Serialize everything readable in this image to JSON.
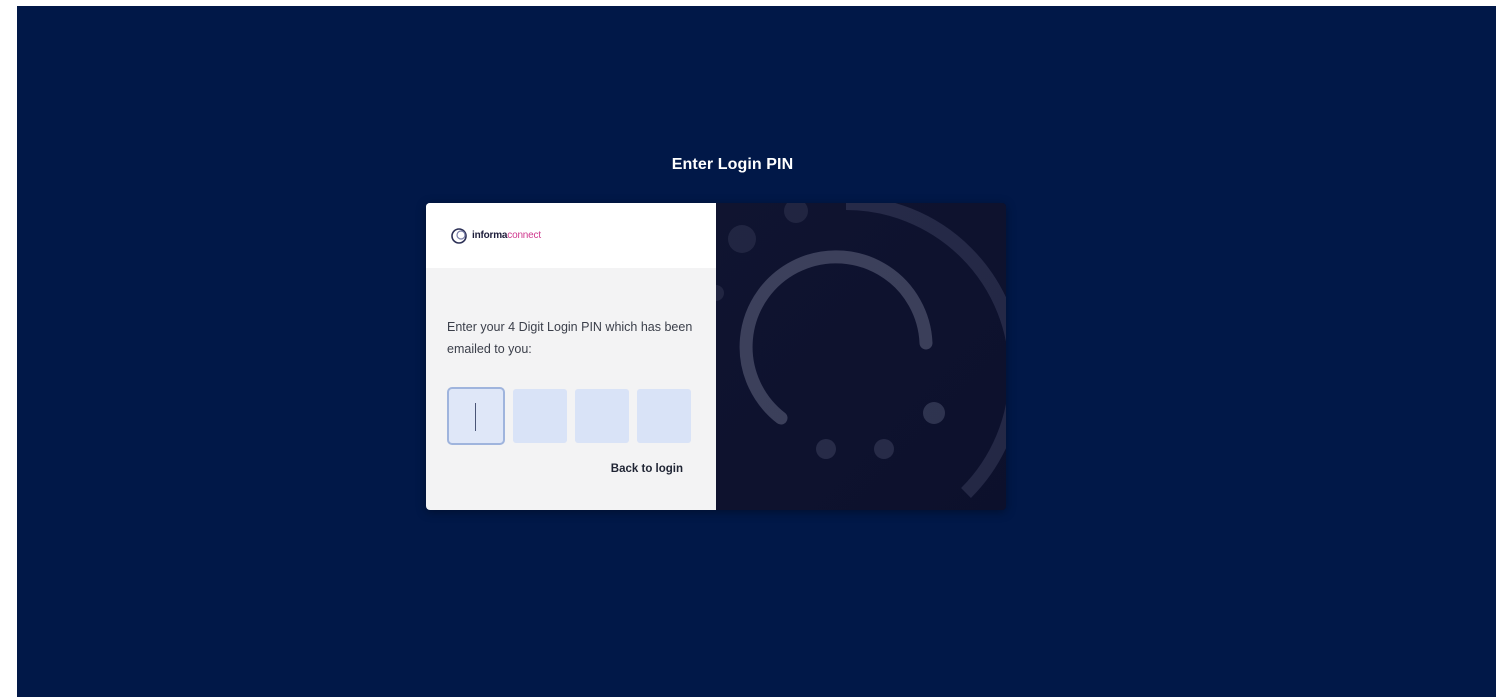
{
  "page": {
    "heading": "Enter Login PIN"
  },
  "brand": {
    "name_part1": "informa",
    "name_part2": "connect",
    "accent_color": "#d0388e"
  },
  "form": {
    "prompt": "Enter your 4 Digit Login PIN which has been emailed to you:",
    "pin_values": [
      "",
      "",
      "",
      ""
    ],
    "back_link_label": "Back to login"
  },
  "colors": {
    "background": "#011848",
    "panel_dark": "#0b0f2b",
    "pin_box": "#d9e3f7"
  }
}
